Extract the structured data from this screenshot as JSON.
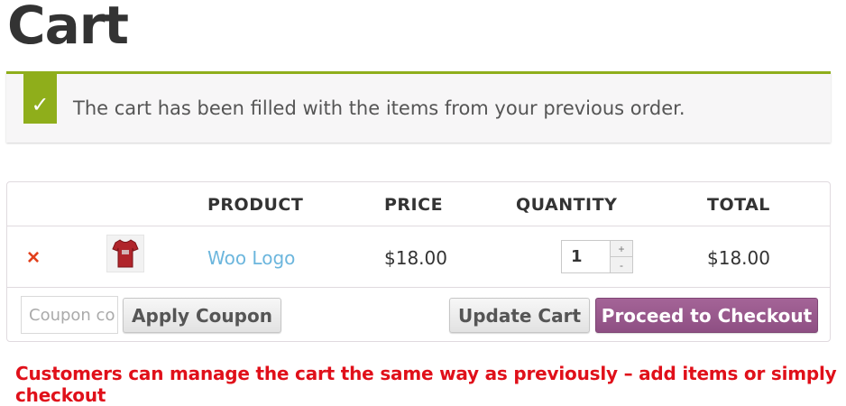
{
  "page": {
    "title": "Cart"
  },
  "notice": {
    "icon": "check-icon",
    "message": "The cart has been filled with the items from your previous order."
  },
  "table": {
    "headers": {
      "product": "PRODUCT",
      "price": "PRICE",
      "quantity": "QUANTITY",
      "total": "TOTAL"
    },
    "items": [
      {
        "remove_label": "×",
        "thumbnail": "t-shirt-icon",
        "product": "Woo Logo",
        "price": "$18.00",
        "quantity": "1",
        "total": "$18.00"
      }
    ],
    "quantity_controls": {
      "increment": "+",
      "decrement": "-"
    }
  },
  "actions": {
    "coupon_placeholder": "Coupon code",
    "apply_coupon": "Apply Coupon",
    "update_cart": "Update Cart",
    "checkout": "Proceed to Checkout"
  },
  "footnote": "Customers can manage the cart the same way as previously – add items or simply checkout",
  "colors": {
    "accent_green": "#8fae1b",
    "checkout_purple": "#9b5c8f",
    "link_blue": "#6cb6dd",
    "remove_red": "#e2401c",
    "footnote_red": "#e0101a"
  }
}
